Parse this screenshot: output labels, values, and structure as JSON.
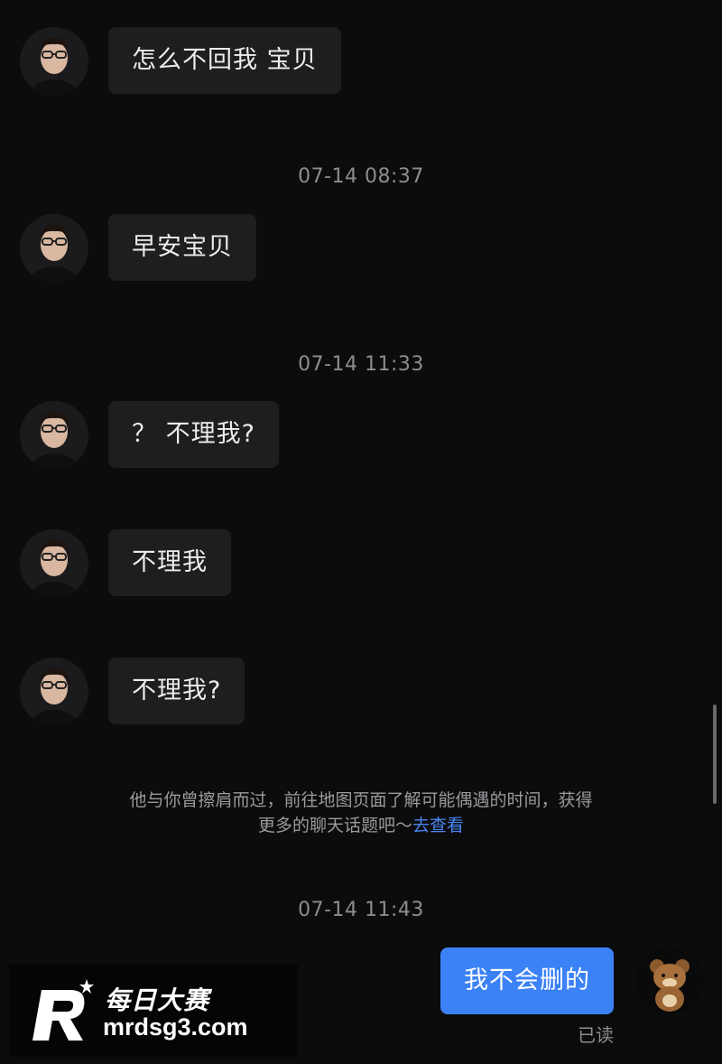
{
  "messages": [
    {
      "sender": "other",
      "text": "怎么不回我 宝贝"
    },
    {
      "type": "timestamp",
      "text": "07-14 08:37"
    },
    {
      "sender": "other",
      "text": "早安宝贝"
    },
    {
      "type": "timestamp",
      "text": "07-14 11:33"
    },
    {
      "sender": "other",
      "text": "？ 不理我?"
    },
    {
      "sender": "other",
      "text": "不理我"
    },
    {
      "sender": "other",
      "text": "不理我?"
    },
    {
      "type": "system",
      "text_line1": "他与你曾擦肩而过，前往地图页面了解可能偶遇的时间，获得",
      "text_line2": "更多的聊天话题吧～",
      "link_text": "去查看"
    },
    {
      "type": "timestamp",
      "text": "07-14 11:43"
    },
    {
      "sender": "me",
      "text": "我不会删的",
      "status": "已读"
    }
  ],
  "watermark": {
    "brand": "每日大赛",
    "url": "mrdsg3.com"
  },
  "colors": {
    "background": "#0c0c0d",
    "incoming_bubble": "#1e1e20",
    "outgoing_bubble": "#3b82f6",
    "link": "#4a86f0"
  }
}
